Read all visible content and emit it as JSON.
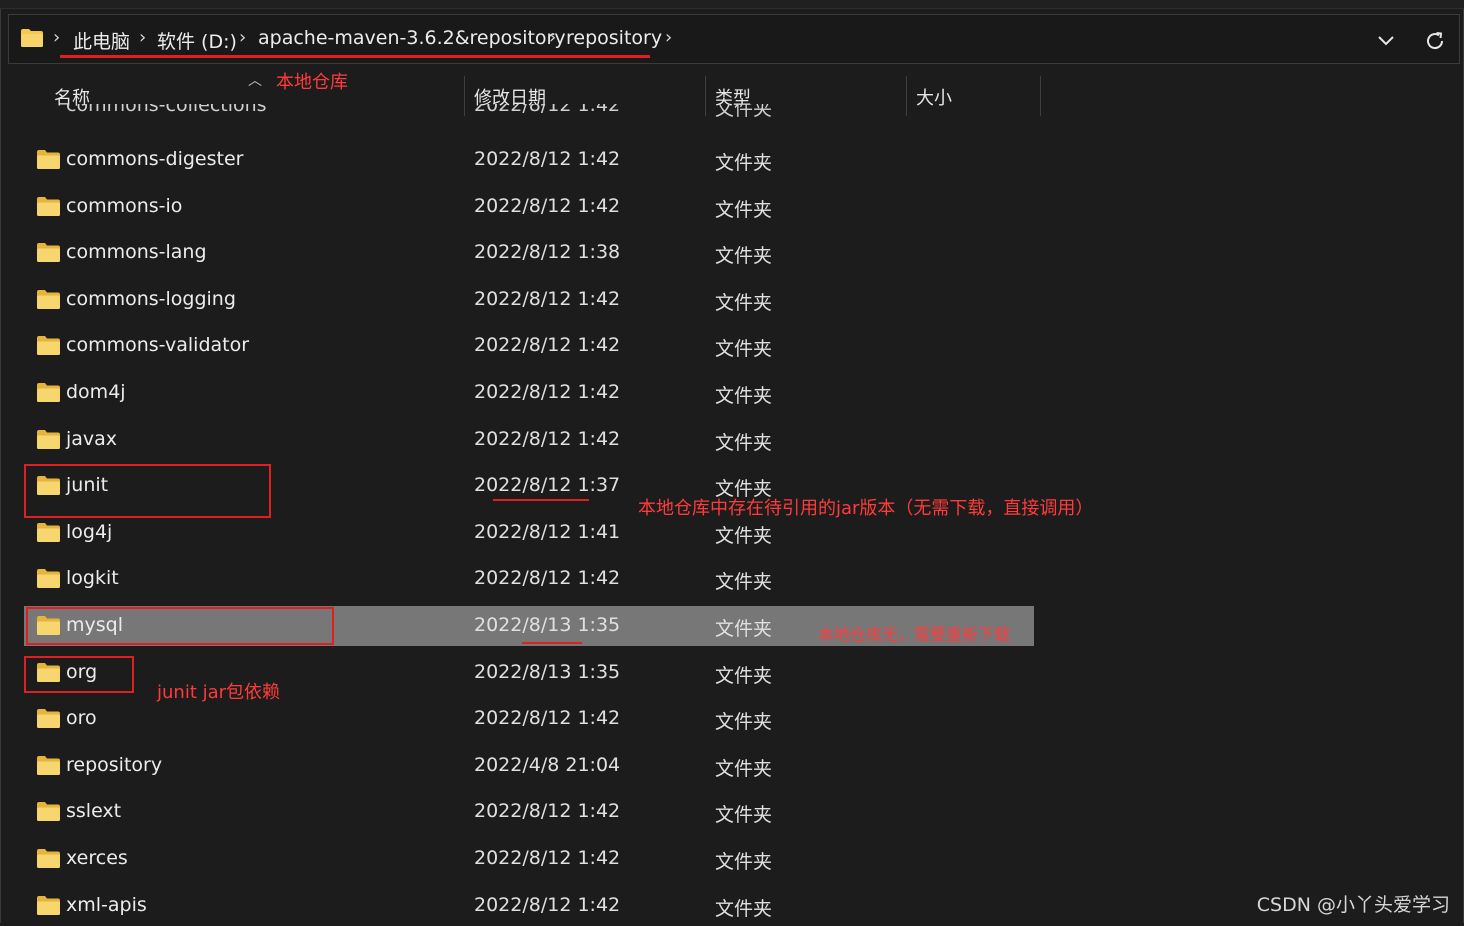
{
  "address": {
    "crumbs": [
      "此电脑",
      "软件 (D:)",
      "apache-maven-3.6.2&repository",
      "repository"
    ],
    "separator": "›"
  },
  "columns": {
    "name": "名称",
    "modified": "修改日期",
    "type": "类型",
    "size": "大小"
  },
  "partial_row": {
    "name": "commons-collections",
    "date": "2022/8/12 1:42",
    "type": "文件夹"
  },
  "files": [
    {
      "name": "commons-digester",
      "date": "2022/8/12 1:42",
      "type": "文件夹"
    },
    {
      "name": "commons-io",
      "date": "2022/8/12 1:42",
      "type": "文件夹"
    },
    {
      "name": "commons-lang",
      "date": "2022/8/12 1:38",
      "type": "文件夹"
    },
    {
      "name": "commons-logging",
      "date": "2022/8/12 1:42",
      "type": "文件夹"
    },
    {
      "name": "commons-validator",
      "date": "2022/8/12 1:42",
      "type": "文件夹"
    },
    {
      "name": "dom4j",
      "date": "2022/8/12 1:42",
      "type": "文件夹"
    },
    {
      "name": "javax",
      "date": "2022/8/12 1:42",
      "type": "文件夹"
    },
    {
      "name": "junit",
      "date": "2022/8/12 1:37",
      "type": "文件夹"
    },
    {
      "name": "log4j",
      "date": "2022/8/12 1:41",
      "type": "文件夹"
    },
    {
      "name": "logkit",
      "date": "2022/8/12 1:42",
      "type": "文件夹"
    },
    {
      "name": "mysql",
      "date": "2022/8/13 1:35",
      "type": "文件夹"
    },
    {
      "name": "org",
      "date": "2022/8/13 1:35",
      "type": "文件夹"
    },
    {
      "name": "oro",
      "date": "2022/8/12 1:42",
      "type": "文件夹"
    },
    {
      "name": "repository",
      "date": "2022/4/8 21:04",
      "type": "文件夹"
    },
    {
      "name": "sslext",
      "date": "2022/8/12 1:42",
      "type": "文件夹"
    },
    {
      "name": "xerces",
      "date": "2022/8/12 1:42",
      "type": "文件夹"
    },
    {
      "name": "xml-apis",
      "date": "2022/8/12 1:42",
      "type": "文件夹"
    }
  ],
  "selected_file": "mysql",
  "annotations": {
    "local_repo": "本地仓库",
    "junit_exists": "本地仓库中存在待引用的jar版本（无需下载，直接调用）",
    "mysql_missing": "本地仓库无，需要重新下载",
    "junit_dependency": "junit  jar包依赖"
  },
  "watermark": "CSDN @小丫头爱学习",
  "colors": {
    "background": "#1c1c1c",
    "selected_row": "#777777",
    "annotation": "#e02020",
    "folder": "#f2c94c"
  },
  "icons": [
    "folder-icon",
    "chevron-down-icon",
    "refresh-icon",
    "sort-up-icon"
  ]
}
